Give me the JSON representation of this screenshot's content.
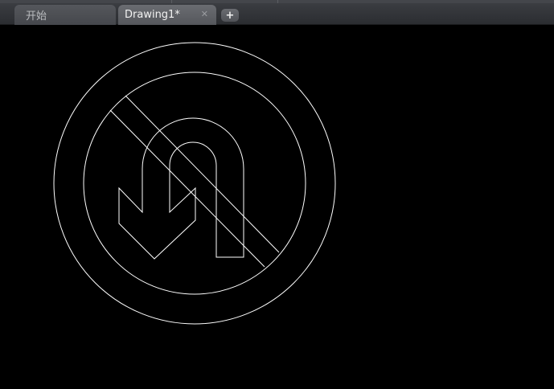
{
  "tabs": [
    {
      "label": "开始",
      "active": false
    },
    {
      "label": "Drawing1*",
      "active": true,
      "close_glyph": "✕"
    }
  ],
  "new_tab_glyph": "+",
  "canvas": {
    "background": "#000000",
    "stroke_color": "#ffffff",
    "drawing_description_icon": "no-u-turn-sign"
  }
}
